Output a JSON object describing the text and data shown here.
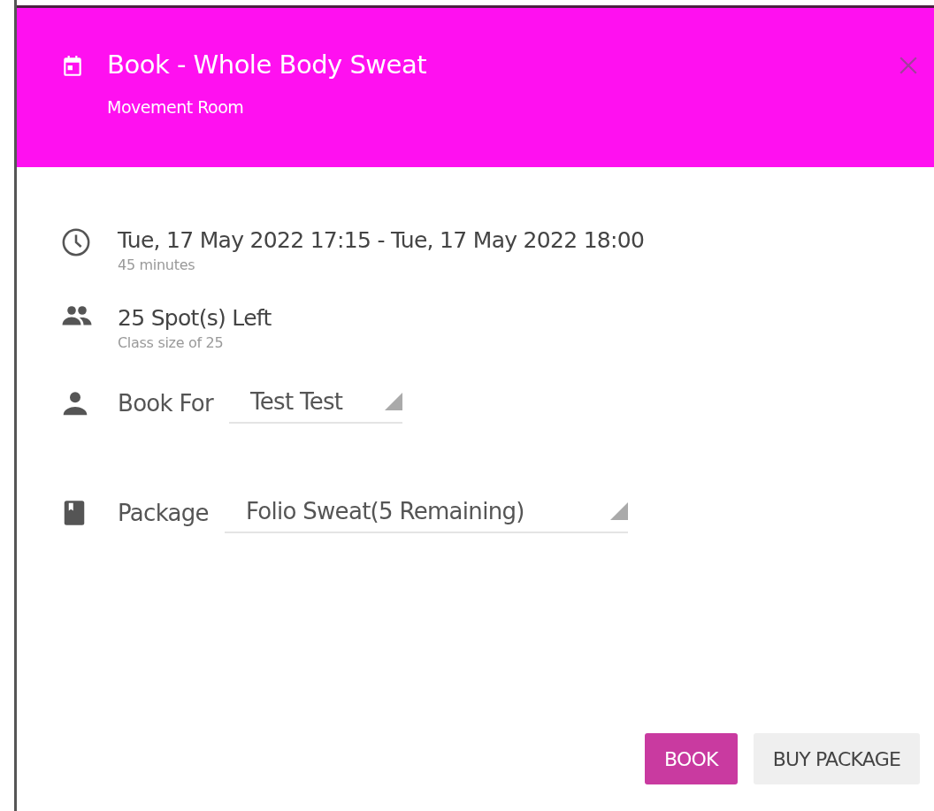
{
  "dialog": {
    "title": "Book - Whole Body Sweat",
    "subtitle": "Movement Room"
  },
  "details": [
    {
      "kind": "time",
      "main": "Tue, 17 May 2022 17:15 - Tue, 17 May 2022 18:00",
      "sub": "45 minutes"
    },
    {
      "kind": "spots",
      "main": "25 Spot(s) Left",
      "sub": "Class size of 25"
    }
  ],
  "fields": [
    {
      "kind": "person",
      "label": "Book For",
      "value": "Test Test"
    },
    {
      "kind": "package",
      "label": "Package",
      "value": "Folio Sweat(5 Remaining)"
    }
  ],
  "buttons": [
    {
      "kind": "primary",
      "label": "BOOK"
    },
    {
      "kind": "secondary",
      "label": "BUY PACKAGE"
    }
  ]
}
